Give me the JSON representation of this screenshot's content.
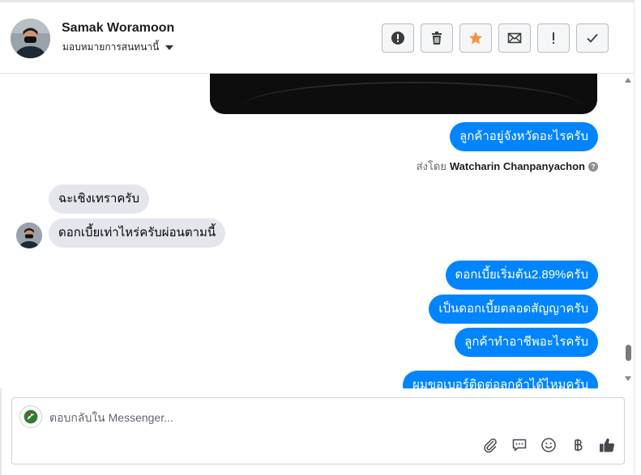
{
  "contact": {
    "name": "Samak Woramoon",
    "assignee": "มอบหมายการสนทนานี้"
  },
  "toolbar": {
    "buttons": [
      {
        "name": "spam-button",
        "icon": "exclamation-circle-icon"
      },
      {
        "name": "delete-button",
        "icon": "trash-icon"
      },
      {
        "name": "star-button",
        "icon": "star-icon",
        "color": "#f7923b"
      },
      {
        "name": "mark-unread-button",
        "icon": "envelope-icon"
      },
      {
        "name": "follow-up-button",
        "icon": "exclamation-icon"
      },
      {
        "name": "done-button",
        "icon": "check-icon"
      }
    ]
  },
  "messages": {
    "out_1": "ลูกค้าอยู่จังหวัดอะไรครับ",
    "sent_by_prefix": "ส่งโดย",
    "sent_by_name": "Watcharin Chanpanyachon",
    "in_1": "ฉะเชิงเทราครับ",
    "in_2": "ดอกเบี้ยเท่าไหร่ครับผ่อนตามนี้",
    "out_2": "ดอกเบี้ยเริ่มต้น2.89%ครับ",
    "out_3": "เป็นดอกเบี้ยตลอดสัญญาครับ",
    "out_4": "ลูกค้าทำอาชีพอะไรครับ",
    "out_5": "ผมขอเบอร์ติดต่อลูกค้าได้ไหมครับ"
  },
  "composer": {
    "placeholder": "ตอบกลับใน Messenger..."
  },
  "colors": {
    "outgoing_bubble": "#0084ff",
    "incoming_bubble": "#e4e6eb",
    "star": "#f7923b"
  }
}
